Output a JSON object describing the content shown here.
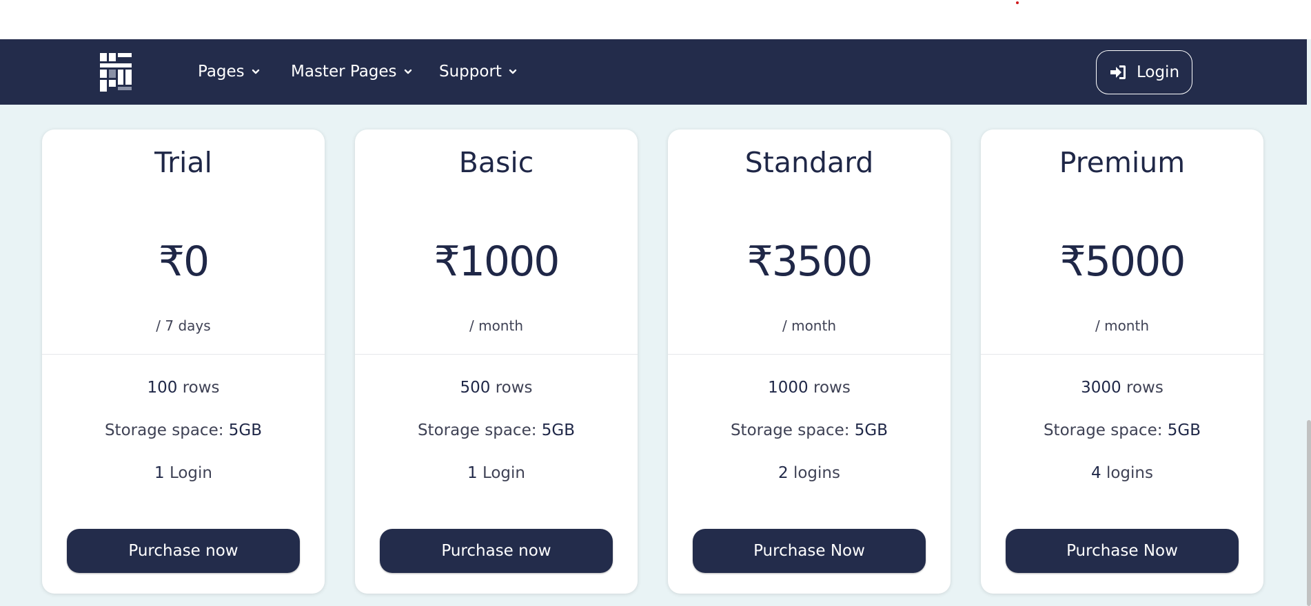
{
  "nav": {
    "logo": "logo-icon",
    "items": [
      {
        "label": "Pages"
      },
      {
        "label": "Master Pages"
      },
      {
        "label": "Support"
      }
    ],
    "login_label": "Login"
  },
  "colors": {
    "navbar": "#232c4b",
    "page_background": "#e9f3f5",
    "card": "#ffffff",
    "primary_text": "#1f2747",
    "button": "#232c4b"
  },
  "plans": [
    {
      "name": "Trial",
      "price": "₹0",
      "period": "/ 7 days",
      "rows_value": "100",
      "rows_label": "rows",
      "storage_label": "Storage space:",
      "storage_value": "5GB",
      "logins_value": "1",
      "logins_label": "Login",
      "button": "Purchase now"
    },
    {
      "name": "Basic",
      "price": "₹1000",
      "period": "/ month",
      "rows_value": "500",
      "rows_label": "rows",
      "storage_label": "Storage space:",
      "storage_value": "5GB",
      "logins_value": "1",
      "logins_label": "Login",
      "button": "Purchase now"
    },
    {
      "name": "Standard",
      "price": "₹3500",
      "period": "/ month",
      "rows_value": "1000",
      "rows_label": "rows",
      "storage_label": "Storage space:",
      "storage_value": "5GB",
      "logins_value": "2",
      "logins_label": "logins",
      "button": "Purchase Now"
    },
    {
      "name": "Premium",
      "price": "₹5000",
      "period": "/ month",
      "rows_value": "3000",
      "rows_label": "rows",
      "storage_label": "Storage space:",
      "storage_value": "5GB",
      "logins_value": "4",
      "logins_label": "logins",
      "button": "Purchase Now"
    }
  ]
}
